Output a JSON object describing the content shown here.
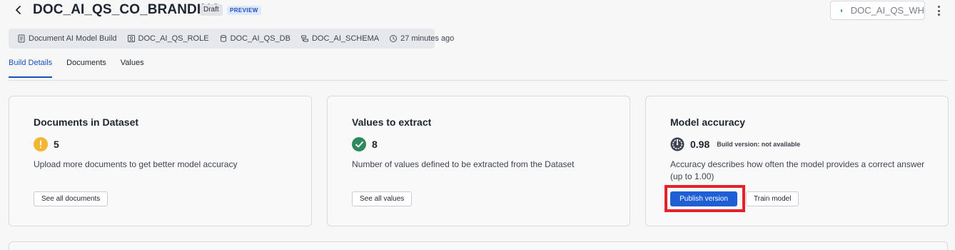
{
  "header": {
    "title": "DOC_AI_QS_CO_BRANDING",
    "draft_badge": "Draft",
    "preview_badge": "PREVIEW",
    "warehouse": "DOC_AI_QS_WH"
  },
  "meta": {
    "type": "Document AI Model Build",
    "role": "DOC_AI_QS_ROLE",
    "database": "DOC_AI_QS_DB",
    "schema": "DOC_AI_SCHEMA",
    "updated": "27 minutes ago"
  },
  "tabs": [
    {
      "label": "Build Details",
      "active": true
    },
    {
      "label": "Documents",
      "active": false
    },
    {
      "label": "Values",
      "active": false
    }
  ],
  "cards": {
    "documents": {
      "title": "Documents in Dataset",
      "value": "5",
      "description": "Upload more documents to get better model accuracy",
      "button": "See all documents"
    },
    "values": {
      "title": "Values to extract",
      "value": "8",
      "description": "Number of values defined to be extracted from the Dataset",
      "button": "See all values"
    },
    "accuracy": {
      "title": "Model accuracy",
      "value": "0.98",
      "build_version": "Build version: not available",
      "description": "Accuracy describes how often the model provides a correct answer (up to 1.00)",
      "publish_button": "Publish version",
      "train_button": "Train model"
    }
  },
  "colors": {
    "accent": "#1f5fd6",
    "warning": "#f2b630",
    "success": "#2e8a5e",
    "highlight": "#e5222a"
  }
}
